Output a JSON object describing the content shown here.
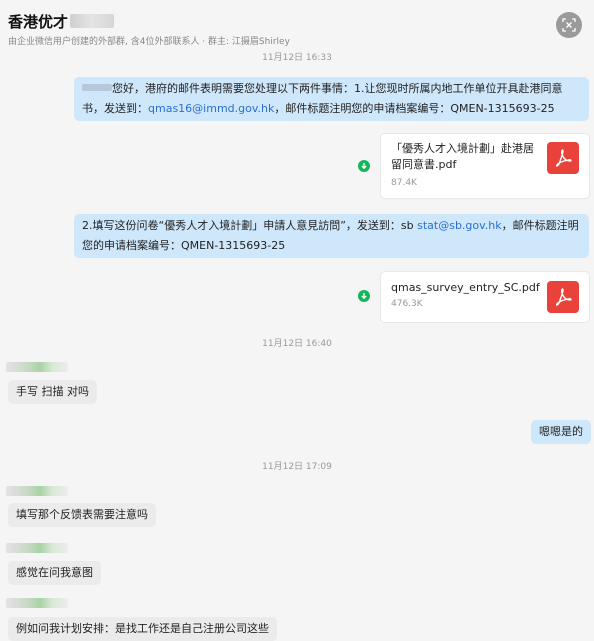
{
  "header": {
    "title": "香港优才",
    "subtitle": "由企业微信用户创建的外部群, 含4位外部联系人 · 群主: 江摄眉Shirley"
  },
  "messages": {
    "time_top": "11月12日 16:33",
    "msg1": {
      "part1": "您好，港府的邮件表明需要您处理以下两件事情：1.让您现时所属内地工作单位开具赴港同意书，发送到：",
      "email": "qmas16@immd.gov.hk",
      "part2": "，邮件标题注明您的申请档案编号：QMEN-1315693-25"
    },
    "file1": {
      "name": "「優秀人才入境計劃」赴港居留同意書.pdf",
      "size": "87.4K"
    },
    "msg2": {
      "part1": "2.填写这份问卷“優秀人才入境計劃」申請人意見訪問”，发送到：sb ",
      "email": "stat@sb.gov.hk",
      "part2": "，邮件标题注明您的申请档案编号：QMEN-1315693-25"
    },
    "file2": {
      "name": "qmas_survey_entry_SC.pdf",
      "size": "476.3K"
    },
    "time2": "11月12日 16:40",
    "msg3": "手写 扫描 对吗",
    "msg4": "嗯嗯是的",
    "time3": "11月12日 17:09",
    "msg5": "填写那个反馈表需要注意吗",
    "msg6": "感觉在问我意图",
    "msg7": "例如问我计划安排：是找工作还是自己注册公司这些"
  },
  "colors": {
    "my_bubble": "#cfe7fb",
    "their_bubble": "#ebebeb",
    "link": "#2a6fd1",
    "pdf_red": "#e8423a",
    "download_green": "#16b55a"
  },
  "icons": [
    "close-icon",
    "pdf-icon",
    "download-icon"
  ]
}
